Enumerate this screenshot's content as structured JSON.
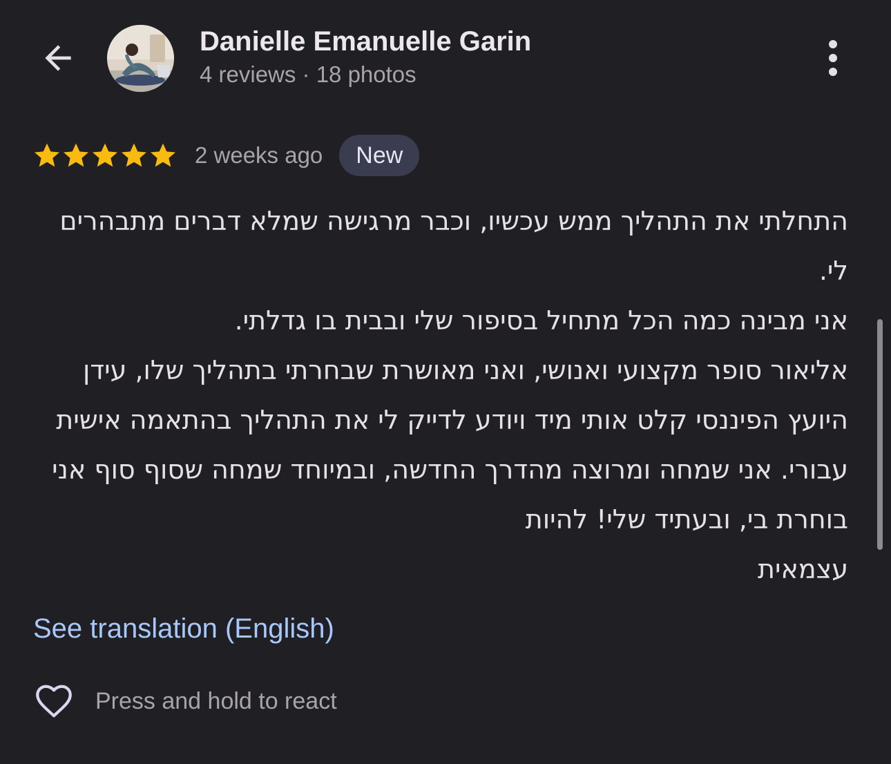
{
  "header": {
    "back_icon": "arrow-left-icon",
    "author_name": "Danielle Emanuelle Garin",
    "author_meta": "4 reviews · 18 photos",
    "more_icon": "more-vertical-icon"
  },
  "review": {
    "rating": 5,
    "rating_max": 5,
    "star_color": "#f9bb12",
    "date": "2 weeks ago",
    "badge": "New",
    "lines": [
      "התחלתי את התהליך ממש עכשיו, וכבר מרגישה שמלא דברים מתבהרים לי.",
      "אני מבינה כמה הכל מתחיל בסיפור שלי ובבית בו גדלתי.",
      "אליאור סופר מקצועי ואנושי, ואני מאושרת שבחרתי בתהליך שלו, עידן היועץ הפיננסי קלט אותי מיד ויודע לדייק לי את התהליך בהתאמה אישית עבורי. אני שמחה ומרוצה מהדרך החדשה, ובמיוחד שמחה שסוף סוף אני בוחרת בי, ובעתיד שלי! להיות",
      "עצמאית"
    ],
    "translation_link": "See translation (English)",
    "link_color": "#a8c7fa"
  },
  "actions": {
    "react_icon": "heart-icon",
    "react_label": "Press and hold to react"
  },
  "colors": {
    "background": "#201f24",
    "badge_background": "#3a3d4f"
  }
}
